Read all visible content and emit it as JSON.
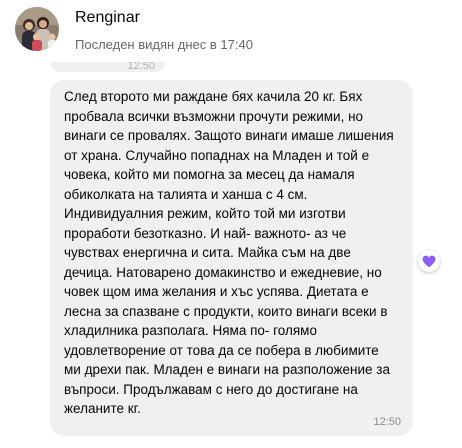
{
  "contact": {
    "name": "Renginar",
    "status": "Последен видян днес в 17:40"
  },
  "previous_message": {
    "time": "12:50"
  },
  "message": {
    "text": "След второто ми раждане бях качила 20 кг. Бях\nпробвала всички възможни прочути режими, но\nвинаги се провалях. Защото винаги имаше лишения\nот храна. Случайно попаднах на Младен и той е\nчовека, който ми помогна за месец да   намаля\nобиколката на талията и ханша с 4 см.\nИндивидуалния режим, който той ми изготви\nпроработи безотказно. И най- важното- аз че\nчувствах енергична и сита. Майка съм на две\nдечица. Натоварено домакинство и ежедневие, но\nчовек щом има желания и хъс успява. Диетата е\nлесна за спазване с продукти, които винаги всеки в\nхладилника разполага. Няма по- голямо\nудовлетворение от това да се побера в любимите\nми дрехи пак. Младен е винаги на разположение за\nвъпроси. Продължавам с него до достигане на\nжеланите кг.",
    "time": "12:50"
  },
  "reaction": {
    "icon": "purple-heart-icon",
    "color": "#8b5cf6"
  }
}
